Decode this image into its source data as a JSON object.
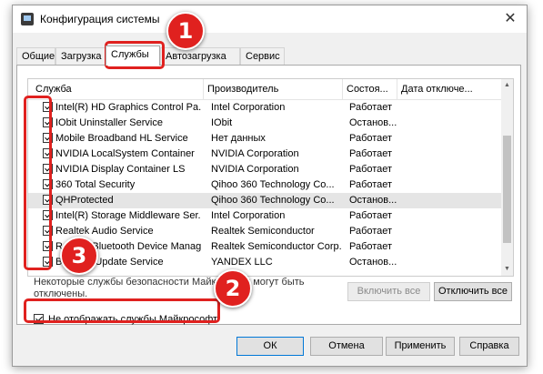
{
  "window": {
    "title": "Конфигурация системы",
    "close_glyph": "✕"
  },
  "tabs": [
    {
      "label": "Общие"
    },
    {
      "label": "Загрузка"
    },
    {
      "label": "Службы",
      "active": true
    },
    {
      "label": "Автозагрузка"
    },
    {
      "label": "Сервис"
    }
  ],
  "columns": [
    "Служба",
    "Производитель",
    "Состоя...",
    "Дата отключе..."
  ],
  "services": [
    {
      "name": "Intel(R) HD Graphics Control Pa...",
      "vendor": "Intel Corporation",
      "status": "Работает",
      "checked": true
    },
    {
      "name": "IObit Uninstaller Service",
      "vendor": "IObit",
      "status": "Останов...",
      "checked": true
    },
    {
      "name": "Mobile Broadband HL Service",
      "vendor": "Нет данных",
      "status": "Работает",
      "checked": true
    },
    {
      "name": "NVIDIA LocalSystem Container",
      "vendor": "NVIDIA Corporation",
      "status": "Работает",
      "checked": true
    },
    {
      "name": "NVIDIA Display Container LS",
      "vendor": "NVIDIA Corporation",
      "status": "Работает",
      "checked": true
    },
    {
      "name": "360 Total Security",
      "vendor": "Qihoo 360 Technology Co...",
      "status": "Работает",
      "checked": true
    },
    {
      "name": "QHProtected",
      "vendor": "Qihoo 360 Technology Co...",
      "status": "Останов...",
      "checked": true,
      "selected": true
    },
    {
      "name": "Intel(R) Storage Middleware Ser...",
      "vendor": "Intel Corporation",
      "status": "Работает",
      "checked": true
    },
    {
      "name": "Realtek Audio Service",
      "vendor": "Realtek Semiconductor",
      "status": "Работает",
      "checked": true
    },
    {
      "name": "Realtek Bluetooth Device Manag...",
      "vendor": "Realtek Semiconductor Corp.",
      "status": "Работает",
      "checked": true
    },
    {
      "name": "Browser Update Service",
      "vendor": "YANDEX LLC",
      "status": "Останов...",
      "checked": true
    }
  ],
  "note": "Некоторые службы безопасности Майкрософт могут быть отключены.",
  "buttons": {
    "enable_all": "Включить все",
    "disable_all": "Отключить все",
    "ok": "ОК",
    "cancel": "Отмена",
    "apply": "Применить",
    "help": "Справка"
  },
  "hide_ms": {
    "label": "Не отображать службы Майкрософт",
    "checked": true
  },
  "annotations": [
    "1",
    "2",
    "3"
  ],
  "colors": {
    "highlight": "#e0211f",
    "focus": "#0078d7"
  }
}
